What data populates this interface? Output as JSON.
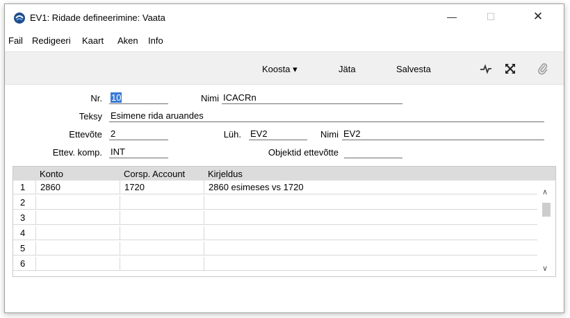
{
  "window": {
    "title": "EV1: Ridade defineerimine: Vaata",
    "controls": {
      "minimize": "—",
      "maximize": "☐",
      "close": "✕"
    }
  },
  "menu": [
    "Fail",
    "Redigeeri",
    "Kaart",
    "Aken",
    "Info"
  ],
  "toolbar": {
    "koosta": "Koosta ▾",
    "jata": "Jäta",
    "salvesta": "Salvesta",
    "icons": [
      "pulse-icon",
      "expand-icon",
      "paperclip-icon"
    ]
  },
  "form": {
    "nr_label": "Nr.",
    "nr_value": "10",
    "nimi_label": "Nimi",
    "nimi_value": "ICACRn",
    "teksy_label": "Teksy",
    "teksy_value": "Esimene rida aruandes",
    "ettevote_label": "Ettevõte",
    "ettevote_value": "2",
    "luh_label": "Lüh.",
    "luh_value": "EV2",
    "nimi2_label": "Nimi",
    "nimi2_value": "EV2",
    "ettev_komp_label": "Ettev. komp.",
    "ettev_komp_value": "INT",
    "objektid_label": "Objektid ettevõtte",
    "objektid_value": ""
  },
  "grid": {
    "columns": [
      "Konto",
      "Corsp. Account",
      "Kirjeldus"
    ],
    "rows": [
      {
        "n": "1",
        "konto": "2860",
        "corsp": "1720",
        "kirjeldus": "2860 esimeses vs 1720"
      },
      {
        "n": "2",
        "konto": "",
        "corsp": "",
        "kirjeldus": ""
      },
      {
        "n": "3",
        "konto": "",
        "corsp": "",
        "kirjeldus": ""
      },
      {
        "n": "4",
        "konto": "",
        "corsp": "",
        "kirjeldus": ""
      },
      {
        "n": "5",
        "konto": "",
        "corsp": "",
        "kirjeldus": ""
      },
      {
        "n": "6",
        "konto": "",
        "corsp": "",
        "kirjeldus": ""
      }
    ]
  }
}
